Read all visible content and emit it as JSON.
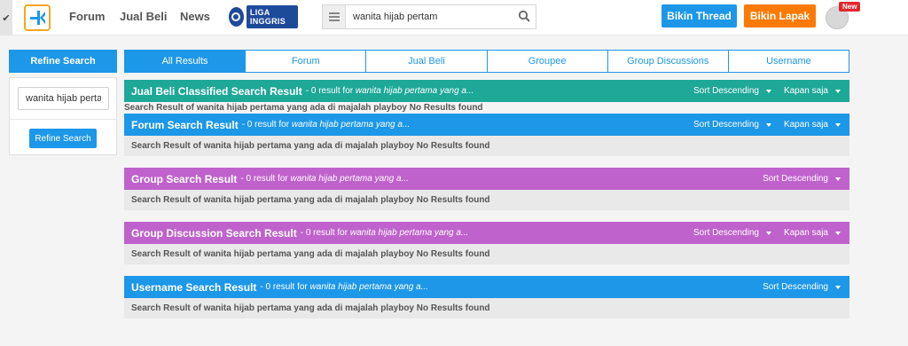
{
  "header": {
    "back_glyph": "✔",
    "logo_icon": "kaskus-logo-icon",
    "nav": [
      "Forum",
      "Jual Beli",
      "News"
    ],
    "liga_label": "LIGA INGGRIS",
    "search_value": "wanita hijab pertam",
    "bikin_thread": "Bikin Thread",
    "bikin_lapak": "Bikin Lapak",
    "new_badge": "New"
  },
  "sidebar": {
    "title": "Refine Search",
    "input_value": "wanita hijab pertam",
    "button": "Refine Search"
  },
  "tabs": [
    "All Results",
    "Forum",
    "Jual Beli",
    "Groupee",
    "Group Discussions",
    "Username"
  ],
  "sections": [
    {
      "title": "Jual Beli Classified Search Result",
      "count_text": "- 0 result for",
      "query": "wanita hijab pertama yang a...",
      "sort": "Sort Descending",
      "time": "Kapan saja",
      "body": "Search Result of wanita hijab pertama yang ada di majalah playboy No Results found"
    },
    {
      "title": "Forum Search Result",
      "count_text": "- 0 result for",
      "query": "wanita hijab pertama yang a...",
      "sort": "Sort Descending",
      "time": "Kapan saja",
      "body": "Search Result of wanita hijab pertama yang ada di majalah playboy No Results found"
    },
    {
      "title": "Group Search Result",
      "count_text": "- 0 result for",
      "query": "wanita hijab pertama yang a...",
      "sort": "Sort Descending",
      "body": "Search Result of wanita hijab pertama yang ada di majalah playboy No Results found"
    },
    {
      "title": "Group Discussion Search Result",
      "count_text": "- 0 result for",
      "query": "wanita hijab pertama yang a...",
      "sort": "Sort Descending",
      "time": "Kapan saja",
      "body": "Search Result of wanita hijab pertama yang ada di majalah playboy No Results found"
    },
    {
      "title": "Username Search Result",
      "count_text": "- 0 result for",
      "query": "wanita hijab pertama yang a...",
      "sort": "Sort Descending",
      "body": "Search Result of wanita hijab pertama yang ada di majalah playboy No Results found"
    }
  ],
  "colors": {
    "primary_blue": "#1d97e8",
    "jual_beli_green": "#1ea898",
    "group_purple": "#bf62cc",
    "lapak_orange": "#fd7a02"
  }
}
